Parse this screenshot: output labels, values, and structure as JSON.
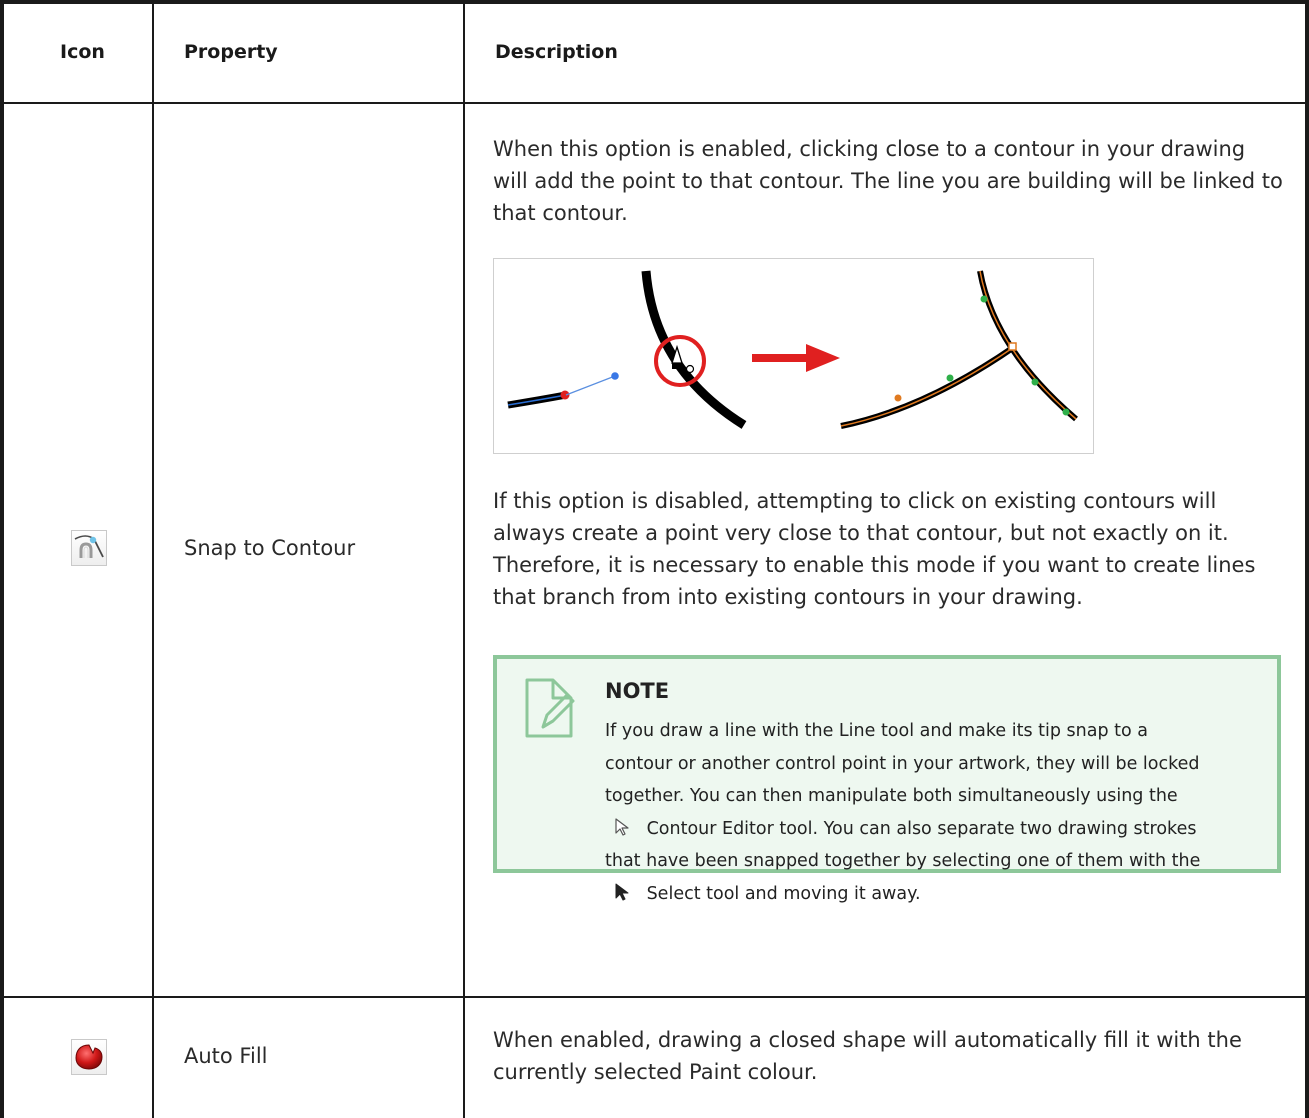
{
  "table": {
    "headers": {
      "icon": "Icon",
      "property": "Property",
      "description": "Description"
    },
    "rows": [
      {
        "icon_name": "snap-to-contour-icon",
        "property": "Snap to Contour",
        "description_1": "When this option is enabled, clicking close to a contour in your drawing will add the point to that contour. The line you are building will be linked to that contour.",
        "description_2": "If this option is disabled, attempting to click on existing contours will always create a point very close to that contour, but not exactly on it. Therefore, it is necessary to enable this mode if you want to create lines that branch from into existing contours in your drawing.",
        "note": {
          "title": "NOTE",
          "text_1": "If you draw a line with the Line tool and make its tip snap to a contour or another control point in your artwork, they will be locked together. You can then manipulate both simultaneously using the",
          "text_2": "Contour Editor tool. You can also separate two drawing strokes that have been snapped together by selecting one of them with the",
          "text_3": "Select tool and moving it away."
        }
      },
      {
        "icon_name": "auto-fill-icon",
        "property": "Auto Fill",
        "description_1": "When enabled, drawing a closed shape will automatically fill it with the currently selected Paint colour."
      }
    ]
  },
  "colors": {
    "note_border": "#8dc79a",
    "note_background": "#eef8f0",
    "snap_circle": "#e02020",
    "arrow": "#e02020",
    "stroke_highlight": "#e07a20"
  }
}
